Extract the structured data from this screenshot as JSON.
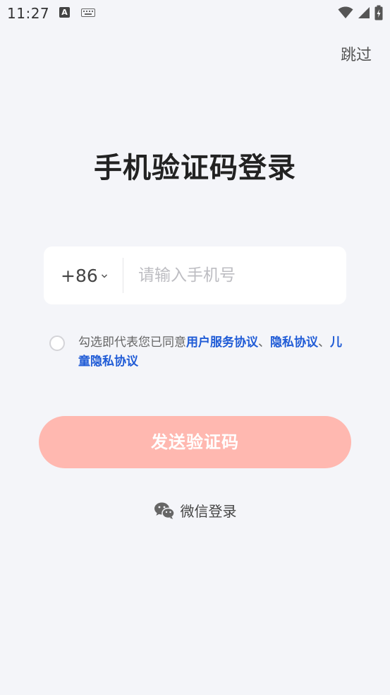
{
  "status_bar": {
    "time": "11:27",
    "a_badge": "A",
    "icons": [
      "a-notification-icon",
      "keyboard-icon",
      "wifi-icon",
      "signal-icon",
      "battery-icon"
    ]
  },
  "header": {
    "skip_label": "跳过"
  },
  "title": "手机验证码登录",
  "phone": {
    "country_code": "+86",
    "placeholder": "请输入手机号",
    "value": ""
  },
  "agreement": {
    "prefix": "勾选即代表您已同意",
    "user_agreement": "用户服务协议",
    "separator1": "、",
    "privacy_policy": "隐私协议",
    "separator2": "、",
    "children_privacy": "儿童隐私协议",
    "checked": false
  },
  "send_code_label": "发送验证码",
  "wechat_login_label": "微信登录",
  "colors": {
    "background": "#f4f5f9",
    "button_disabled": "#ffb8b0",
    "link": "#1f5bd6"
  }
}
